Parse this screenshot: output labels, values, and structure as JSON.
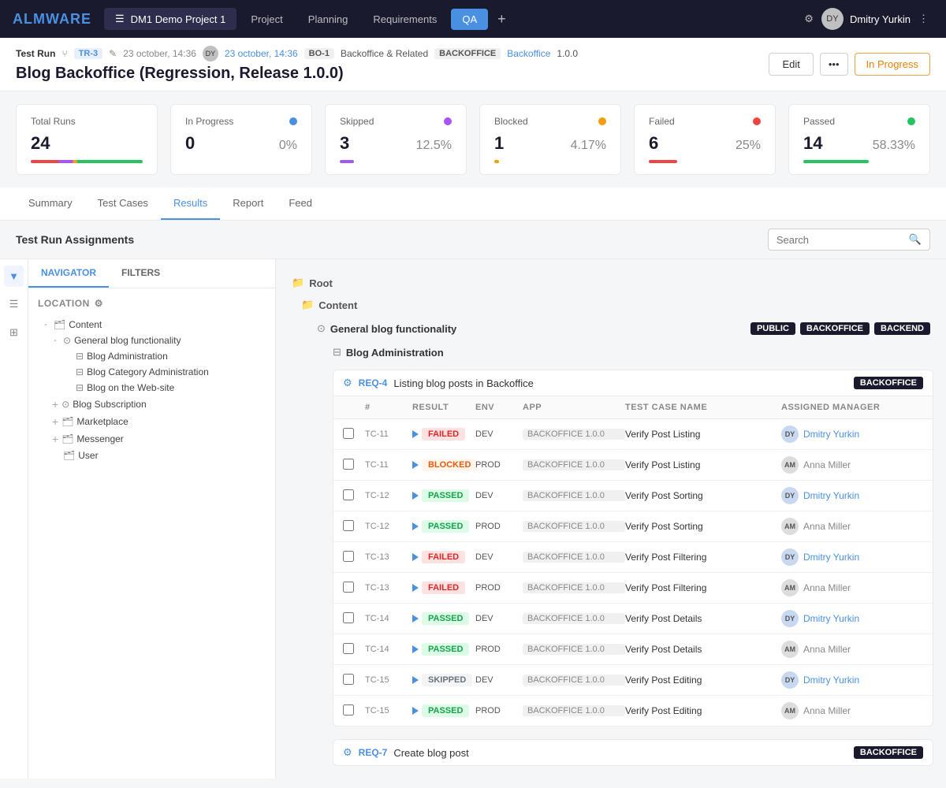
{
  "brand": {
    "logo_text_1": "ALM",
    "logo_text_2": "WARE"
  },
  "nav": {
    "project_icon": "☰",
    "project_name": "DM1 Demo Project 1",
    "items": [
      {
        "label": "Project",
        "active": false
      },
      {
        "label": "Planning",
        "active": false
      },
      {
        "label": "Requirements",
        "active": false
      },
      {
        "label": "QA",
        "active": true
      }
    ],
    "plus": "+",
    "settings_icon": "⚙",
    "user_name": "Dmitry Yurkin",
    "user_initials": "DY",
    "more_icon": "⋮"
  },
  "breadcrumb": {
    "run_label": "Test Run",
    "tag": "TR-3",
    "date": "23 october, 14:36",
    "bo_badge": "BO-1",
    "group": "Backoffice & Related",
    "backoffice_label": "BACKOFFICE",
    "backoffice_link": "Backoffice",
    "version": "1.0.0",
    "title": "Blog Backoffice (Regression, Release 1.0.0)",
    "btn_edit": "Edit",
    "btn_status": "In Progress"
  },
  "stats": [
    {
      "label": "Total Runs",
      "value": "24",
      "pct": "",
      "color": "total"
    },
    {
      "label": "In Progress",
      "value": "0",
      "pct": "0%",
      "color": "blue"
    },
    {
      "label": "Skipped",
      "value": "3",
      "pct": "12.5%",
      "color": "purple"
    },
    {
      "label": "Blocked",
      "value": "1",
      "pct": "4.17%",
      "color": "orange"
    },
    {
      "label": "Failed",
      "value": "6",
      "pct": "25%",
      "color": "red"
    },
    {
      "label": "Passed",
      "value": "14",
      "pct": "58.33%",
      "color": "green"
    }
  ],
  "tabs": [
    "Summary",
    "Test Cases",
    "Results",
    "Report",
    "Feed"
  ],
  "active_tab": "Results",
  "search": {
    "section_label": "Test Run Assignments",
    "placeholder": "Search"
  },
  "sidebar": {
    "tabs": [
      "NAVIGATOR",
      "FILTERS"
    ],
    "active_tab": "NAVIGATOR",
    "location_label": "Location",
    "tree": [
      {
        "label": "Content",
        "level": 0,
        "type": "folder",
        "open": true
      },
      {
        "label": "General blog functionality",
        "level": 1,
        "type": "component",
        "open": true
      },
      {
        "label": "Blog Administration",
        "level": 2,
        "type": "module"
      },
      {
        "label": "Blog Category Administration",
        "level": 2,
        "type": "module"
      },
      {
        "label": "Blog on the Web-site",
        "level": 2,
        "type": "module"
      },
      {
        "label": "Blog Subscription",
        "level": 1,
        "type": "component"
      },
      {
        "label": "Marketplace",
        "level": 1,
        "type": "folder"
      },
      {
        "label": "Messenger",
        "level": 1,
        "type": "folder"
      },
      {
        "label": "User",
        "level": 1,
        "type": "folder"
      }
    ]
  },
  "results": {
    "root_label": "Root",
    "content_label": "Content",
    "general_blog_label": "General blog functionality",
    "general_blog_tags": [
      "PUBLIC",
      "BACKOFFICE",
      "BACKEND"
    ],
    "blog_admin_label": "Blog Administration",
    "req4_id": "REQ-4",
    "req4_label": "Listing blog posts in Backoffice",
    "req4_tag": "BACKOFFICE",
    "table_headers": [
      "#",
      "RESULT",
      "ENV",
      "APP",
      "TEST CASE NAME",
      "ASSIGNED MANAGER"
    ],
    "rows": [
      {
        "tc": "TC-11",
        "result": "FAILED",
        "env": "DEV",
        "app": "BACKOFFICE 1.0.0",
        "name": "Verify Post Listing",
        "manager": "Dmitry Yurkin",
        "manager_type": "user"
      },
      {
        "tc": "TC-11",
        "result": "BLOCKED",
        "env": "PROD",
        "app": "BACKOFFICE 1.0.0",
        "name": "Verify Post Listing",
        "manager": "Anna Miller",
        "manager_type": "am"
      },
      {
        "tc": "TC-12",
        "result": "PASSED",
        "env": "DEV",
        "app": "BACKOFFICE 1.0.0",
        "name": "Verify Post Sorting",
        "manager": "Dmitry Yurkin",
        "manager_type": "user"
      },
      {
        "tc": "TC-12",
        "result": "PASSED",
        "env": "PROD",
        "app": "BACKOFFICE 1.0.0",
        "name": "Verify Post Sorting",
        "manager": "Anna Miller",
        "manager_type": "am"
      },
      {
        "tc": "TC-13",
        "result": "FAILED",
        "env": "DEV",
        "app": "BACKOFFICE 1.0.0",
        "name": "Verify Post Filtering",
        "manager": "Dmitry Yurkin",
        "manager_type": "user"
      },
      {
        "tc": "TC-13",
        "result": "FAILED",
        "env": "PROD",
        "app": "BACKOFFICE 1.0.0",
        "name": "Verify Post Filtering",
        "manager": "Anna Miller",
        "manager_type": "am"
      },
      {
        "tc": "TC-14",
        "result": "PASSED",
        "env": "DEV",
        "app": "BACKOFFICE 1.0.0",
        "name": "Verify Post Details",
        "manager": "Dmitry Yurkin",
        "manager_type": "user"
      },
      {
        "tc": "TC-14",
        "result": "PASSED",
        "env": "PROD",
        "app": "BACKOFFICE 1.0.0",
        "name": "Verify Post Details",
        "manager": "Anna Miller",
        "manager_type": "am"
      },
      {
        "tc": "TC-15",
        "result": "SKIPPED",
        "env": "DEV",
        "app": "BACKOFFICE 1.0.0",
        "name": "Verify Post Editing",
        "manager": "Dmitry Yurkin",
        "manager_type": "user"
      },
      {
        "tc": "TC-15",
        "result": "PASSED",
        "env": "PROD",
        "app": "BACKOFFICE 1.0.0",
        "name": "Verify Post Editing",
        "manager": "Anna Miller",
        "manager_type": "am"
      }
    ],
    "req7_id": "REQ-7",
    "req7_label": "Create blog post",
    "req7_tag": "BACKOFFICE"
  },
  "colors": {
    "blue": "#4a90e2",
    "purple": "#a855f7",
    "orange": "#f59e0b",
    "red": "#ef4444",
    "green": "#22c55e"
  }
}
